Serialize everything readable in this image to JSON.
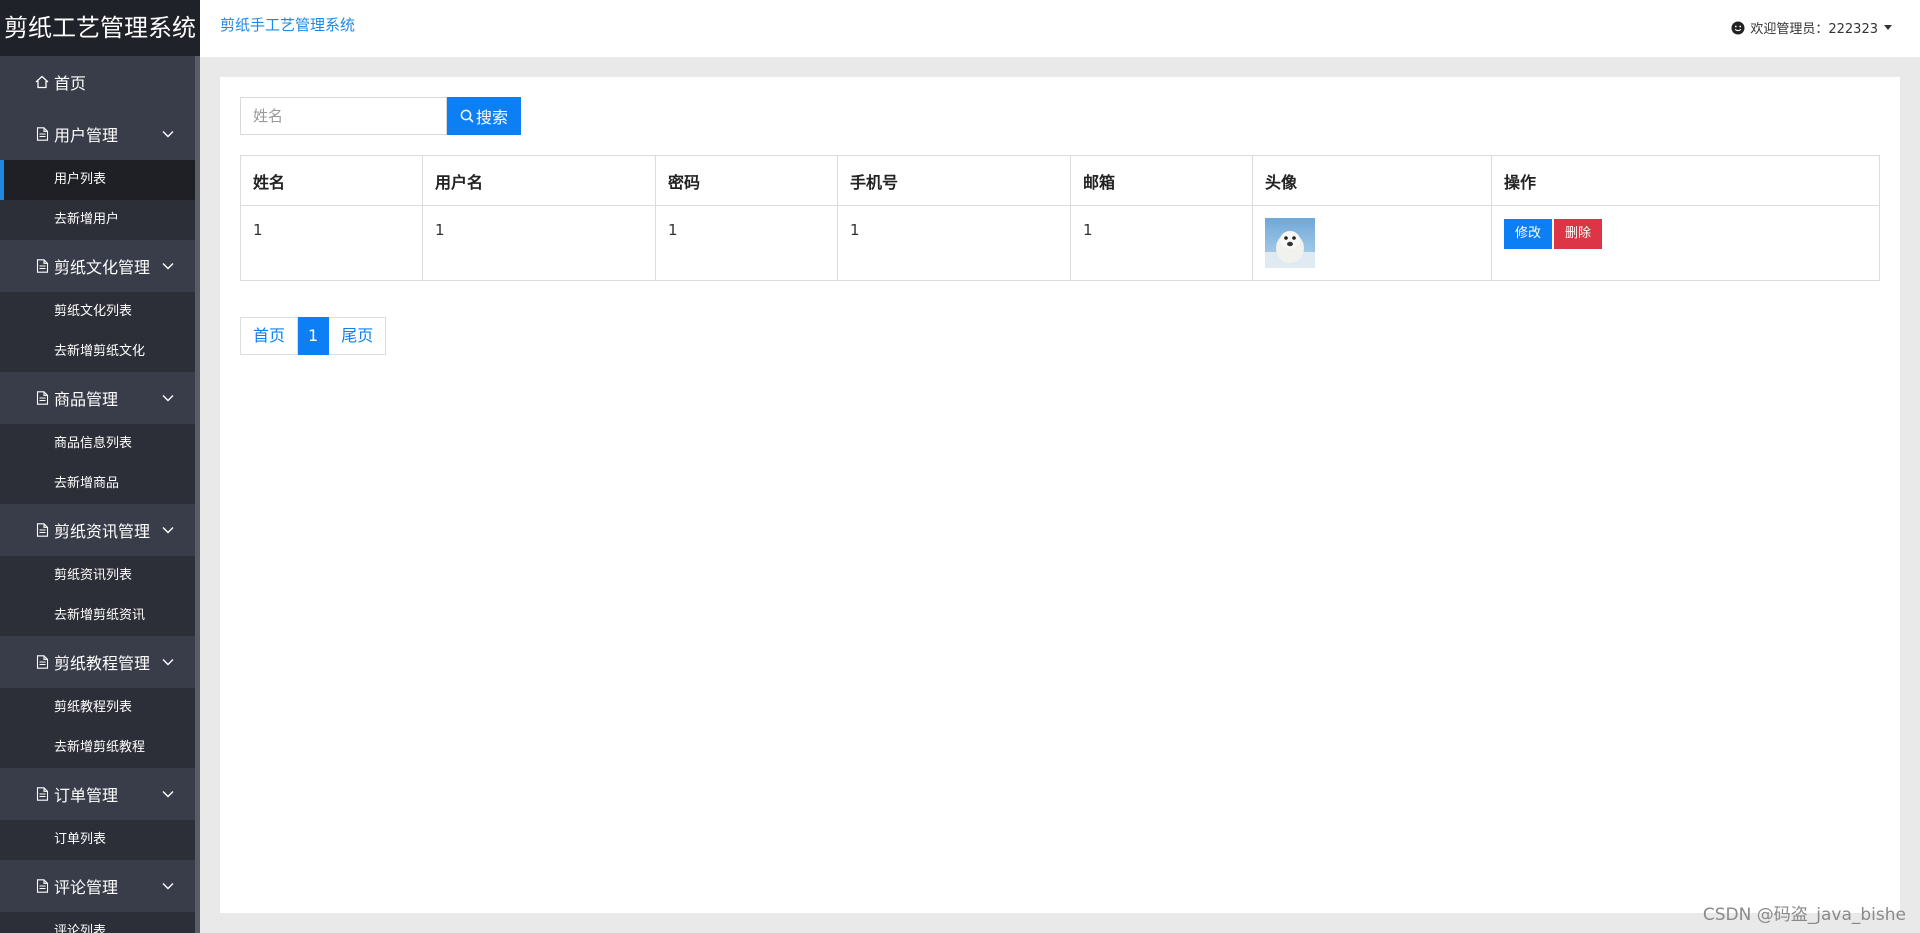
{
  "sidebar": {
    "logo": "剪纸工艺管理系统",
    "home": "首页",
    "groups": [
      {
        "label": "用户管理",
        "items": [
          "用户列表",
          "去新增用户"
        ]
      },
      {
        "label": "剪纸文化管理",
        "items": [
          "剪纸文化列表",
          "去新增剪纸文化"
        ]
      },
      {
        "label": "商品管理",
        "items": [
          "商品信息列表",
          "去新增商品"
        ]
      },
      {
        "label": "剪纸资讯管理",
        "items": [
          "剪纸资讯列表",
          "去新增剪纸资讯"
        ]
      },
      {
        "label": "剪纸教程管理",
        "items": [
          "剪纸教程列表",
          "去新增剪纸教程"
        ]
      },
      {
        "label": "订单管理",
        "items": [
          "订单列表"
        ]
      },
      {
        "label": "评论管理",
        "items": [
          "评论列表"
        ]
      }
    ],
    "active_item": "用户列表"
  },
  "header": {
    "title": "剪纸手工艺管理系统",
    "user_greeting": "欢迎管理员：222323"
  },
  "search": {
    "placeholder": "姓名",
    "value": "",
    "button_label": "搜索"
  },
  "table": {
    "columns": [
      "姓名",
      "用户名",
      "密码",
      "手机号",
      "邮箱",
      "头像",
      "操作"
    ],
    "rows": [
      {
        "name": "1",
        "username": "1",
        "password": "1",
        "phone": "1",
        "email": "1",
        "avatar": "seal-photo"
      }
    ],
    "edit_label": "修改",
    "delete_label": "删除"
  },
  "pagination": {
    "first": "首页",
    "current": "1",
    "last": "尾页"
  },
  "watermark": "CSDN @码盗_java_bishe",
  "colors": {
    "sidebar_bg": "#393d49",
    "logo_bg": "#1f2229",
    "accent": "#0d7ff5",
    "danger": "#dc3545"
  }
}
